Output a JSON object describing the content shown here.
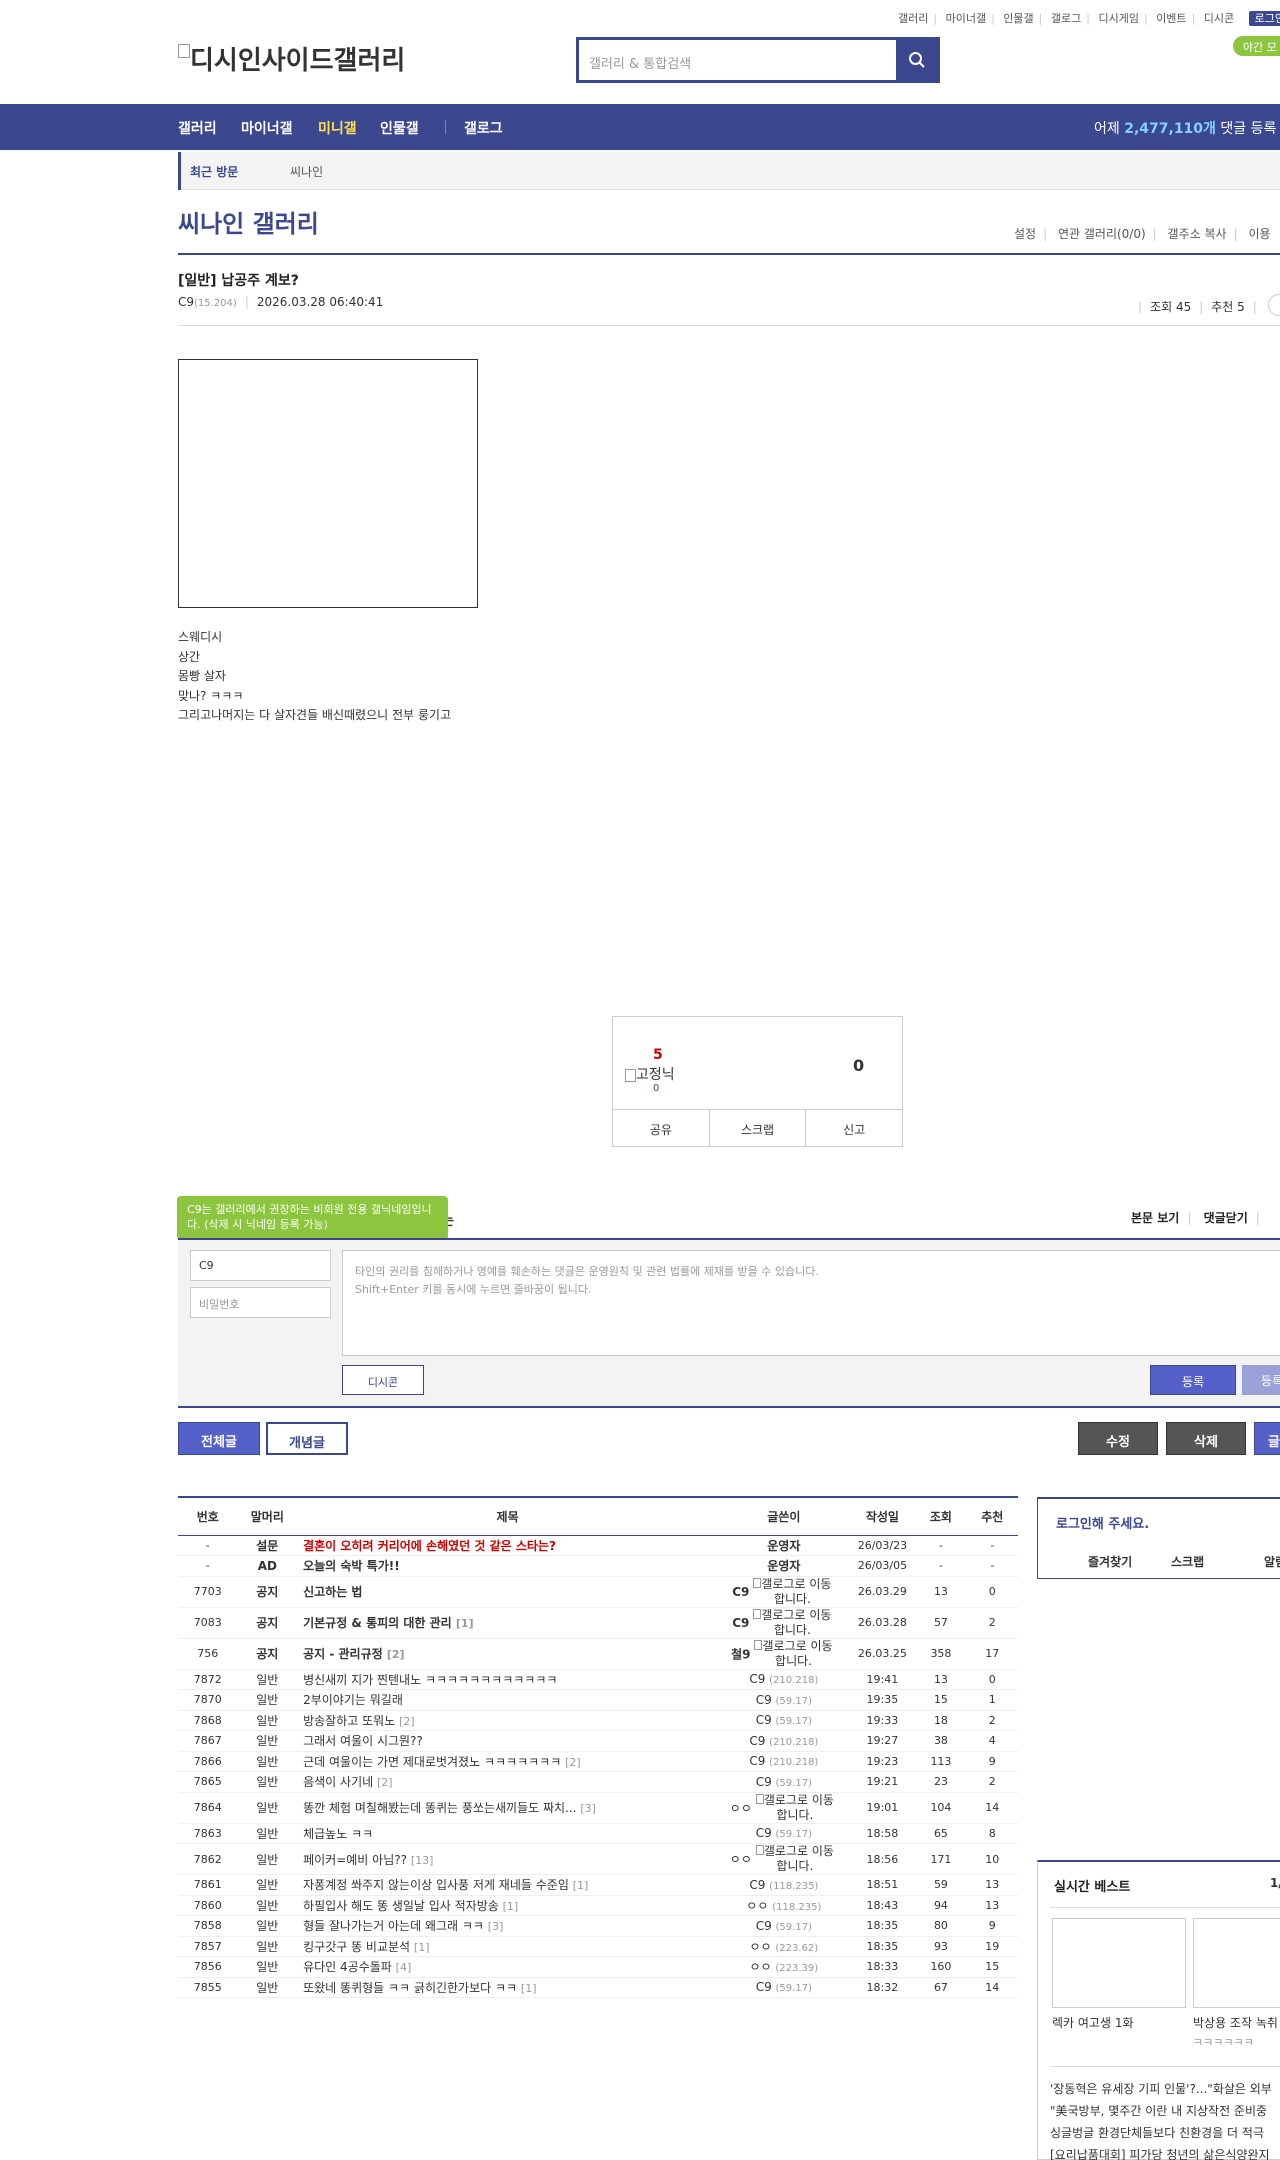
{
  "header": {
    "util_links": [
      "갤러리",
      "마이너갤",
      "인물갤",
      "갤로그",
      "디시게임",
      "이벤트",
      "디시콘"
    ],
    "login_label": "로그인",
    "night_mode": "야간 모",
    "logo_alt": "디시인사이드갤러리",
    "search_placeholder": "갤러리 & 통합검색"
  },
  "nav": {
    "items": [
      "갤러리",
      "마이너갤",
      "미니갤",
      "인물갤",
      "갤로그"
    ],
    "active": "미니갤",
    "stat_prefix": "어제",
    "stat_value": "2,477,110개",
    "stat_suffix": "댓글 등록"
  },
  "recent": {
    "label": "최근 방문",
    "items": [
      "씨나인"
    ]
  },
  "gallery": {
    "title": "씨나인 갤러리",
    "menu": [
      "설정",
      "연관 갤러리(0/0)",
      "갤주소 복사",
      "이용"
    ]
  },
  "post": {
    "title": "[일반] 납공주 계보?",
    "author": "C9",
    "author_ip": "(15.204)",
    "date": "2026.03.28 06:40:41",
    "views_label": "조회 45",
    "recommend_label": "추천 5",
    "body_lines": [
      "스웨디시",
      "상간",
      "몸빵 살자",
      "맞나? ㅋㅋㅋ",
      "그리고나머지는 다 살자견들 배신때렸으니 전부 룽기고"
    ]
  },
  "recommend": {
    "up": "5",
    "up_alt": "고정닉",
    "fixed_count": "0",
    "down": "0",
    "buttons": [
      "공유",
      "스크랩",
      "신고"
    ]
  },
  "comment": {
    "tip": "C9는 갤러리에서 권장하는 비회원 전용 갤닉네임입니다. (삭제 시 닉네임 등록 가능)",
    "tip_tail": "는",
    "menu": [
      "본문 보기",
      "댓글닫기"
    ],
    "name_value": "C9",
    "password_placeholder": "비밀번호",
    "textarea_line1": "타인의 권리를 침해하거나 명예를 훼손하는 댓글은 운영원칙 및 관련 법률에 제재를 받을 수 있습니다.",
    "textarea_line2": "Shift+Enter 키를 동시에 누르면 줄바꿈이 됩니다.",
    "dccon_label": "디시콘",
    "submit_label": "등록",
    "submit2_label": "등록"
  },
  "list_tabs": {
    "all": "전체글",
    "concept": "개념글"
  },
  "actions": {
    "edit": "수정",
    "delete": "삭제",
    "write": "글"
  },
  "table": {
    "headers": [
      "번호",
      "말머리",
      "제목",
      "글쓴이",
      "작성일",
      "조회",
      "추천"
    ],
    "rows": [
      {
        "no": "-",
        "head": "설문",
        "title": "결혼이 오히려 커리어에 손해였던 것 같은 스타는?",
        "cnt": "",
        "writer": "운영자",
        "ip": "",
        "date": "26/03/23",
        "views": "-",
        "rec": "-",
        "type": "notice-red"
      },
      {
        "no": "-",
        "head": "AD",
        "title": "오늘의 숙박 특가!!",
        "cnt": "",
        "writer": "운영자",
        "ip": "",
        "date": "26/03/05",
        "views": "-",
        "rec": "-",
        "type": "notice"
      },
      {
        "no": "7703",
        "head": "공지",
        "title": "신고하는 법",
        "cnt": "",
        "writer": "C9",
        "ip": "갤로그로 이동합니다.",
        "date": "26.03.29",
        "views": "13",
        "rec": "0",
        "type": "notice-g"
      },
      {
        "no": "7083",
        "head": "공지",
        "title": "기본규정 & 통피의 대한 관리",
        "cnt": "[1]",
        "writer": "C9",
        "ip": "갤로그로 이동합니다.",
        "date": "26.03.28",
        "views": "57",
        "rec": "2",
        "type": "notice-g"
      },
      {
        "no": "756",
        "head": "공지",
        "title": "공지 - 관리규정",
        "cnt": "[2]",
        "writer": "철9",
        "ip": "갤로그로 이동합니다.",
        "date": "26.03.25",
        "views": "358",
        "rec": "17",
        "type": "notice-g"
      },
      {
        "no": "7872",
        "head": "일반",
        "title": "병신새끼 지가 찐텐내노 ㅋㅋㅋㅋㅋㅋㅋㅋㅋㅋㅋㅋ",
        "cnt": "",
        "writer": "C9",
        "ip": "(210.218)",
        "date": "19:41",
        "views": "13",
        "rec": "0",
        "type": "n"
      },
      {
        "no": "7870",
        "head": "일반",
        "title": "2부이야기는 뭐길래",
        "cnt": "",
        "writer": "C9",
        "ip": "(59.17)",
        "date": "19:35",
        "views": "15",
        "rec": "1",
        "type": "n"
      },
      {
        "no": "7868",
        "head": "일반",
        "title": "방송잘하고 또뭐노",
        "cnt": "[2]",
        "writer": "C9",
        "ip": "(59.17)",
        "date": "19:33",
        "views": "18",
        "rec": "2",
        "type": "n"
      },
      {
        "no": "7867",
        "head": "일반",
        "title": "그래서 여울이 시그뭔??",
        "cnt": "",
        "writer": "C9",
        "ip": "(210.218)",
        "date": "19:27",
        "views": "38",
        "rec": "4",
        "type": "n"
      },
      {
        "no": "7866",
        "head": "일반",
        "title": "근데 여울이는 가면 제대로벗겨졌노 ㅋㅋㅋㅋㅋㅋㅋ",
        "cnt": "[2]",
        "writer": "C9",
        "ip": "(210.218)",
        "date": "19:23",
        "views": "113",
        "rec": "9",
        "type": "n"
      },
      {
        "no": "7865",
        "head": "일반",
        "title": "음색이 사기네",
        "cnt": "[2]",
        "writer": "C9",
        "ip": "(59.17)",
        "date": "19:21",
        "views": "23",
        "rec": "2",
        "type": "n"
      },
      {
        "no": "7864",
        "head": "일반",
        "title": "똥깐 체험 며칠해봤는데 똥퀴는 풍쏘는새끼들도 짜치...",
        "cnt": "[3]",
        "writer": "ㅇㅇ",
        "ip": "갤로그로 이동합니다.",
        "date": "19:01",
        "views": "104",
        "rec": "14",
        "type": "g"
      },
      {
        "no": "7863",
        "head": "일반",
        "title": "체급높노 ㅋㅋ",
        "cnt": "",
        "writer": "C9",
        "ip": "(59.17)",
        "date": "18:58",
        "views": "65",
        "rec": "8",
        "type": "n"
      },
      {
        "no": "7862",
        "head": "일반",
        "title": "페이커=예비 아님??",
        "cnt": "[13]",
        "writer": "ㅇㅇ",
        "ip": "갤로그로 이동합니다.",
        "date": "18:56",
        "views": "171",
        "rec": "10",
        "type": "g"
      },
      {
        "no": "7861",
        "head": "일반",
        "title": "자퐁계정 쏴주지 않는이상 입사풍 저게 재네들 수준임",
        "cnt": "[1]",
        "writer": "C9",
        "ip": "(118.235)",
        "date": "18:51",
        "views": "59",
        "rec": "13",
        "type": "n"
      },
      {
        "no": "7860",
        "head": "일반",
        "title": "하필입사 해도 똥 생일날 입사 적자방송",
        "cnt": "[1]",
        "writer": "ㅇㅇ",
        "ip": "(118.235)",
        "date": "18:43",
        "views": "94",
        "rec": "13",
        "type": "n"
      },
      {
        "no": "7858",
        "head": "일반",
        "title": "형들 잘나가는거 아는데 왜그래 ㅋㅋ",
        "cnt": "[3]",
        "writer": "C9",
        "ip": "(59.17)",
        "date": "18:35",
        "views": "80",
        "rec": "9",
        "type": "n"
      },
      {
        "no": "7857",
        "head": "일반",
        "title": "킹구갓구 똥 비교분석",
        "cnt": "[1]",
        "writer": "ㅇㅇ",
        "ip": "(223.62)",
        "date": "18:35",
        "views": "93",
        "rec": "19",
        "type": "n"
      },
      {
        "no": "7856",
        "head": "일반",
        "title": "유다인 4공수돌파",
        "cnt": "[4]",
        "writer": "ㅇㅇ",
        "ip": "(223.39)",
        "date": "18:33",
        "views": "160",
        "rec": "15",
        "type": "n"
      },
      {
        "no": "7855",
        "head": "일반",
        "title": "또왔네 똥퀴형들 ㅋㅋ 긁히긴한가보다 ㅋㅋ",
        "cnt": "[1]",
        "writer": "C9",
        "ip": "(59.17)",
        "date": "18:32",
        "views": "67",
        "rec": "14",
        "type": "n"
      }
    ]
  },
  "sidebar": {
    "login_title": "로그인해 주세요.",
    "login_links": [
      "즐겨찾기",
      "스크랩",
      "알림"
    ],
    "best_title": "실시간 베스트",
    "best_page": "1/",
    "thumbs": [
      {
        "caption": "렉카 여고생 1화",
        "sub": ""
      },
      {
        "caption": "박상용 조작 녹취",
        "sub": "ㅋㅋㅋㅋㅋㅋ"
      }
    ],
    "best_list": [
      "'장동혁은 유세장 기피 인물'?...\"화살은 외부",
      "\"美국방부, 몇주간 이란 내 지상작전 준비중",
      "싱글벙글 환경단체들보다 친환경을 더 적극",
      "[요리납품대회] 피가당 청년의 삶은식양완지"
    ]
  }
}
